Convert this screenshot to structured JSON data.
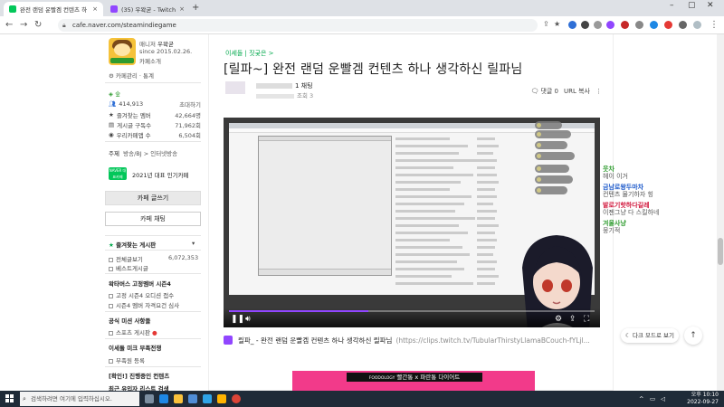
{
  "browser": {
    "tabs": [
      {
        "label": "완전 랜덤 운빨겜 컨텐츠 하",
        "active": true,
        "color": "#03c75a"
      },
      {
        "label": "(35) 우왁굳 - Twitch",
        "active": false,
        "color": "#9146ff"
      }
    ],
    "url": "cafe.naver.com/steamindiegame"
  },
  "sidebar": {
    "manager_label": "매니저",
    "manager_name": "우왁굳",
    "since": "since 2015.02.26.",
    "cafe_intro": "카페소개",
    "community_label": "카페관리",
    "stats_label": "통계",
    "grade": "숲",
    "member_label": "414,913",
    "invite": "초대하기",
    "fav_board": "즐겨찾는 멤버",
    "fav_board_count": "42,664명",
    "posts_label": "게시글 구독수",
    "posts_count": "71,962회",
    "today_label": "우리카페앱 수",
    "today_count": "6,504회",
    "theme_label": "주제",
    "theme_value": "방송/BJ > 인터넷방송",
    "award": "2021년 대표 인기카페",
    "naver_badge": "NAVER 대표카페",
    "write_button": "카페 글쓰기",
    "chat_button": "카페 채팅",
    "favorites_header": "즐겨찾는 게시판",
    "all_posts": "전체글보기",
    "all_posts_count": "6,072,353",
    "best_posts": "베스트게시글",
    "section1": "왁타버스 고정멤버 시즌4",
    "item1": "고정 시즌4 오디션 접수",
    "item2": "시즌4 멤버 자격요건 심사",
    "section2": "공식 미션 사항들",
    "item3": "스포츠 게시판",
    "section3": "이세돌 미크 부족전쟁",
    "item4": "부족원 등록",
    "section4": "[확인!] 진행중인 컨텐츠",
    "section5": "최근 유입자 리스트 검색"
  },
  "article": {
    "breadcrumb": "이세돌 | 짓궂은 >",
    "title": "[릴파~] 완전 랜덤 운빨겜 컨텐츠 하나 생각하신 릴파님",
    "author_suffix": "1 채팅",
    "author_meta": "조회 3",
    "comments": "댓글 0",
    "url_copy": "URL 복사",
    "clip_title": "릴파_ - 완전 랜덤 운빨겜 컨텐츠 하나 생각하신 릴파님",
    "clip_link": "(https://clips.twitch.tv/TubularThirstyLlamaBCouch-fYLjl...",
    "clip_progress": 0.38,
    "banner_text": "빨간통 x 파란통 다이어트",
    "banner_brand": "FOODOLOGY"
  },
  "float_chat": [
    {
      "name": "웃차",
      "color": "#2e9b2e",
      "msg": "헤이 이거"
    },
    {
      "name": "금남로왕두마차",
      "color": "#1a57c9",
      "msg": "컨텐츠 물기하자 힝"
    },
    {
      "name": "발로기핫하다길레",
      "color": "#d0143a",
      "msg": "이젠그냥 다 스킬하네"
    },
    {
      "name": "겨울사냥",
      "color": "#2e9b2e",
      "msg": "뭉기적"
    }
  ],
  "floating": {
    "dark_mode": "다크 모드로 보기",
    "top_icon": "arrow-up-icon"
  },
  "taskbar": {
    "search_placeholder": "검색하려면 여기에 입력하십시오.",
    "time": "오후 10:10",
    "date": "2022-09-27"
  }
}
